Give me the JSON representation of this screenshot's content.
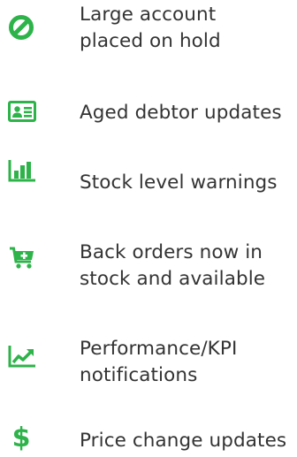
{
  "accent_color": "#2eb34a",
  "text_color": "#333333",
  "items": [
    {
      "icon": "prohibited-icon",
      "label": "Large account\nplaced on hold"
    },
    {
      "icon": "contact-card-icon",
      "label": "Aged debtor updates"
    },
    {
      "icon": "bar-chart-icon",
      "label": "Stock level warnings"
    },
    {
      "icon": "cart-add-icon",
      "label": "Back orders now in\nstock and available"
    },
    {
      "icon": "trend-up-icon",
      "label": "Performance/KPI\nnotifications"
    },
    {
      "icon": "dollar-icon",
      "label": "Price change updates"
    }
  ]
}
